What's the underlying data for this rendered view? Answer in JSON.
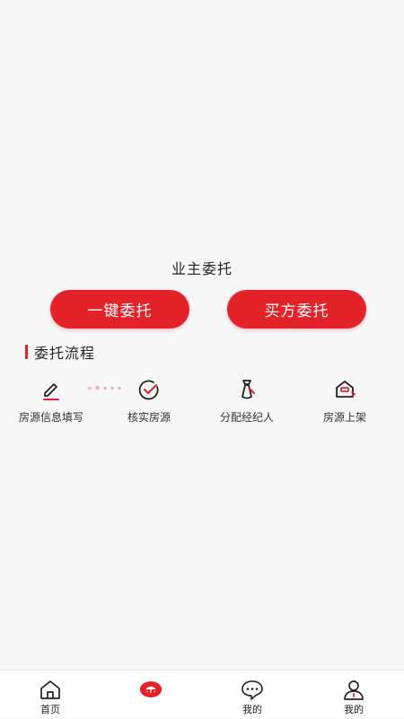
{
  "main": {
    "title": "业主委托",
    "owner_button_label": "一键委托",
    "buyer_button_label": "买方委托"
  },
  "process": {
    "heading": "委托流程",
    "steps": [
      {
        "label": "房源信息填写",
        "icon": "edit-icon"
      },
      {
        "label": "核实房源",
        "icon": "check-circle-icon"
      },
      {
        "label": "分配经纪人",
        "icon": "agent-icon"
      },
      {
        "label": "房源上架",
        "icon": "listing-icon"
      }
    ]
  },
  "tabbar": {
    "items": [
      {
        "label": "首页",
        "icon": "home-icon"
      },
      {
        "label": "",
        "icon": "center-badge-icon"
      },
      {
        "label": "我的",
        "icon": "chat-bubble-icon"
      },
      {
        "label": "我的",
        "icon": "user-icon"
      }
    ]
  },
  "colors": {
    "accent": "#e3222a",
    "background": "#f7f7f7"
  }
}
